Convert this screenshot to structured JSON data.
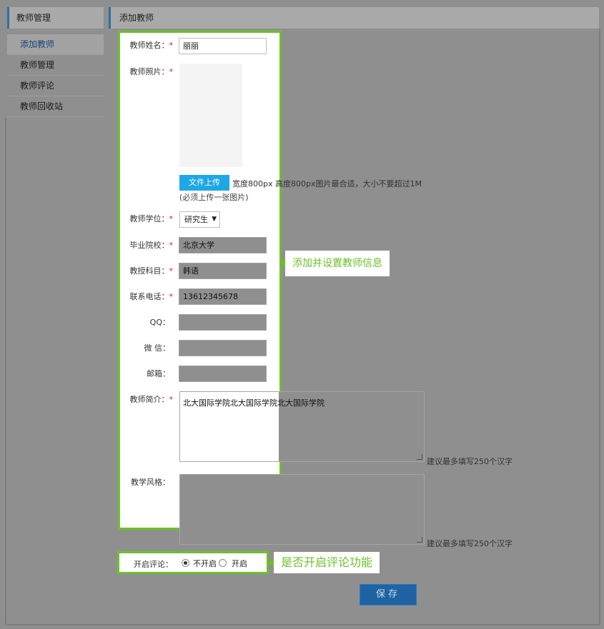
{
  "sidebar": {
    "title": "教师管理",
    "items": [
      {
        "label": "添加教师"
      },
      {
        "label": "教师管理"
      },
      {
        "label": "教师评论"
      },
      {
        "label": "教师回收站"
      }
    ]
  },
  "page": {
    "title": "添加教师"
  },
  "form": {
    "name": {
      "label": "教师姓名：",
      "value": "丽丽"
    },
    "photo": {
      "label": "教师照片：",
      "file_label": "文件上传",
      "size_hint": "宽度800px 高度800px图片最合适，大小不要超过1M",
      "required_hint": "(必须上传一张图片)"
    },
    "degree": {
      "label": "教师学位：",
      "value": "研究生"
    },
    "school": {
      "label": "毕业院校：",
      "value": "北京大学"
    },
    "subject": {
      "label": "教授科目：",
      "value": "韩语"
    },
    "phone": {
      "label": "联系电话：",
      "value": "13612345678"
    },
    "qq": {
      "label": "QQ：",
      "value": ""
    },
    "wechat": {
      "label": "微 信：",
      "value": ""
    },
    "email": {
      "label": "邮箱：",
      "value": ""
    },
    "intro": {
      "label": "教师简介：",
      "value": "北大国际学院北大国际学院北大国际学院",
      "hint": "建议最多填写250个汉字"
    },
    "style": {
      "label": "教学风格：",
      "value": "",
      "hint": "建议最多填写250个汉字"
    },
    "comment": {
      "label": "开启评论：",
      "option_off": "不开启",
      "option_on": "开启",
      "selected": "不开启"
    }
  },
  "save_label": "保存",
  "callouts": {
    "info": "添加并设置教师信息",
    "comment": "是否开启评论功能"
  },
  "colors": {
    "highlight": "#6cc12a",
    "upload": "#1ea7e6",
    "accent": "#2f6fa3"
  }
}
